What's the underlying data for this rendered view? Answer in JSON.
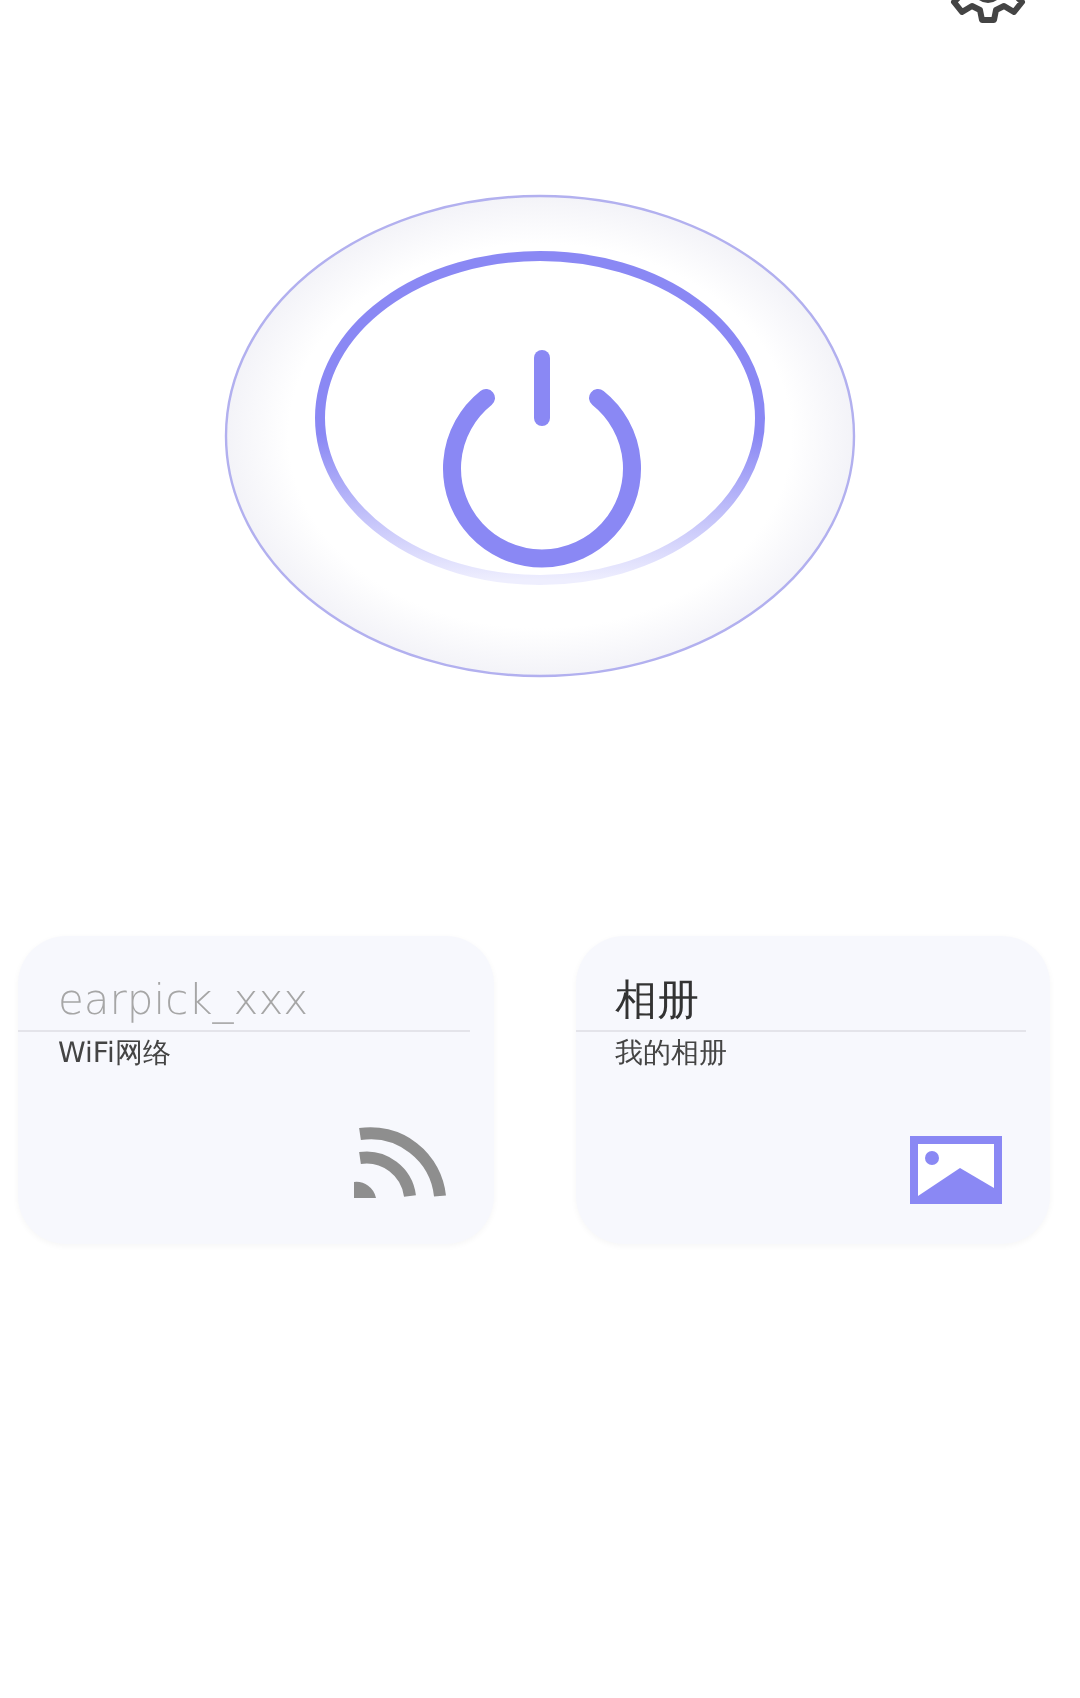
{
  "cards": [
    {
      "kind": "wifi",
      "title": "earpick_xxx",
      "subtitle": "WiFi网络"
    },
    {
      "kind": "album",
      "title": "相册",
      "subtitle": "我的相册"
    }
  ]
}
